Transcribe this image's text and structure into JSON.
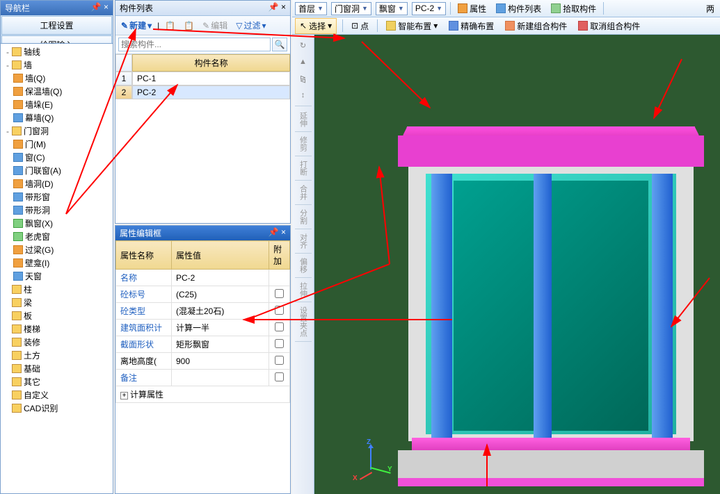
{
  "nav": {
    "title": "导航栏",
    "btn1": "工程设置",
    "btn2": "绘图输入"
  },
  "tree": [
    {
      "level": 1,
      "icon": "folder",
      "toggle": "-",
      "label": "轴线"
    },
    {
      "level": 1,
      "icon": "folder",
      "toggle": "-",
      "label": "墙"
    },
    {
      "level": 2,
      "icon": "orange",
      "label": "墙(Q)"
    },
    {
      "level": 2,
      "icon": "orange",
      "label": "保温墙(Q)"
    },
    {
      "level": 2,
      "icon": "orange",
      "label": "墙垛(E)"
    },
    {
      "level": 2,
      "icon": "blue",
      "label": "幕墙(Q)"
    },
    {
      "level": 1,
      "icon": "folder",
      "toggle": "-",
      "label": "门窗洞"
    },
    {
      "level": 2,
      "icon": "orange",
      "label": "门(M)"
    },
    {
      "level": 2,
      "icon": "blue",
      "label": "窗(C)"
    },
    {
      "level": 2,
      "icon": "blue",
      "label": "门联窗(A)"
    },
    {
      "level": 2,
      "icon": "orange",
      "label": "墙洞(D)"
    },
    {
      "level": 2,
      "icon": "blue",
      "label": "带形窗"
    },
    {
      "level": 2,
      "icon": "blue",
      "label": "带形洞"
    },
    {
      "level": 2,
      "icon": "green",
      "label": "飘窗(X)"
    },
    {
      "level": 2,
      "icon": "green",
      "label": "老虎窗"
    },
    {
      "level": 2,
      "icon": "orange",
      "label": "过梁(G)"
    },
    {
      "level": 2,
      "icon": "orange",
      "label": "壁龛(I)"
    },
    {
      "level": 2,
      "icon": "blue",
      "label": "天窗"
    },
    {
      "level": 1,
      "icon": "folder",
      "label": "柱"
    },
    {
      "level": 1,
      "icon": "folder",
      "label": "梁"
    },
    {
      "level": 1,
      "icon": "folder",
      "label": "板"
    },
    {
      "level": 1,
      "icon": "folder",
      "label": "楼梯"
    },
    {
      "level": 1,
      "icon": "folder",
      "label": "装修"
    },
    {
      "level": 1,
      "icon": "folder",
      "label": "土方"
    },
    {
      "level": 1,
      "icon": "folder",
      "label": "基础"
    },
    {
      "level": 1,
      "icon": "folder",
      "label": "其它"
    },
    {
      "level": 1,
      "icon": "folder",
      "label": "自定义"
    },
    {
      "level": 1,
      "icon": "folder",
      "label": "CAD识别"
    }
  ],
  "complist": {
    "title": "构件列表",
    "new_btn": "新建",
    "edit_btn": "编辑",
    "filter_btn": "过滤",
    "search_placeholder": "搜索构件...",
    "header": "构件名称",
    "rows": [
      {
        "num": "1",
        "name": "PC-1",
        "selected": false
      },
      {
        "num": "2",
        "name": "PC-2",
        "selected": true
      }
    ]
  },
  "props": {
    "title": "属性编辑框",
    "col_name": "属性名称",
    "col_value": "属性值",
    "col_extra": "附加",
    "rows": [
      {
        "name": "名称",
        "value": "PC-2",
        "blue": true,
        "check": false
      },
      {
        "name": "砼标号",
        "value": "(C25)",
        "blue": true,
        "check": true
      },
      {
        "name": "砼类型",
        "value": "(混凝土20石)",
        "blue": true,
        "check": true
      },
      {
        "name": "建筑面积计",
        "value": "计算一半",
        "blue": true,
        "check": true
      },
      {
        "name": "截面形状",
        "value": "矩形飘窗",
        "blue": true,
        "check": true
      },
      {
        "name": "离地高度(",
        "value": "900",
        "blue": false,
        "check": true
      },
      {
        "name": "备注",
        "value": "",
        "blue": true,
        "check": true
      }
    ],
    "calc_props": "计算属性"
  },
  "toolbar": {
    "floor": "首层",
    "category": "门窗洞",
    "type": "飘窗",
    "component": "PC-2",
    "prop_btn": "属性",
    "list_btn": "构件列表",
    "pick_btn": "拾取构件",
    "both_btn": "两",
    "select_btn": "选择",
    "point_btn": "点",
    "smart_btn": "智能布置",
    "exact_btn": "精确布置",
    "newgroup_btn": "新建组合构件",
    "cancelgroup_btn": "取消组合构件"
  },
  "vtools": [
    "延伸",
    "修剪",
    "打断",
    "合并",
    "分割",
    "对齐",
    "偏移",
    "拉伸",
    "设置夹点"
  ],
  "axis": {
    "x": "X",
    "y": "Y",
    "z": "Z"
  }
}
